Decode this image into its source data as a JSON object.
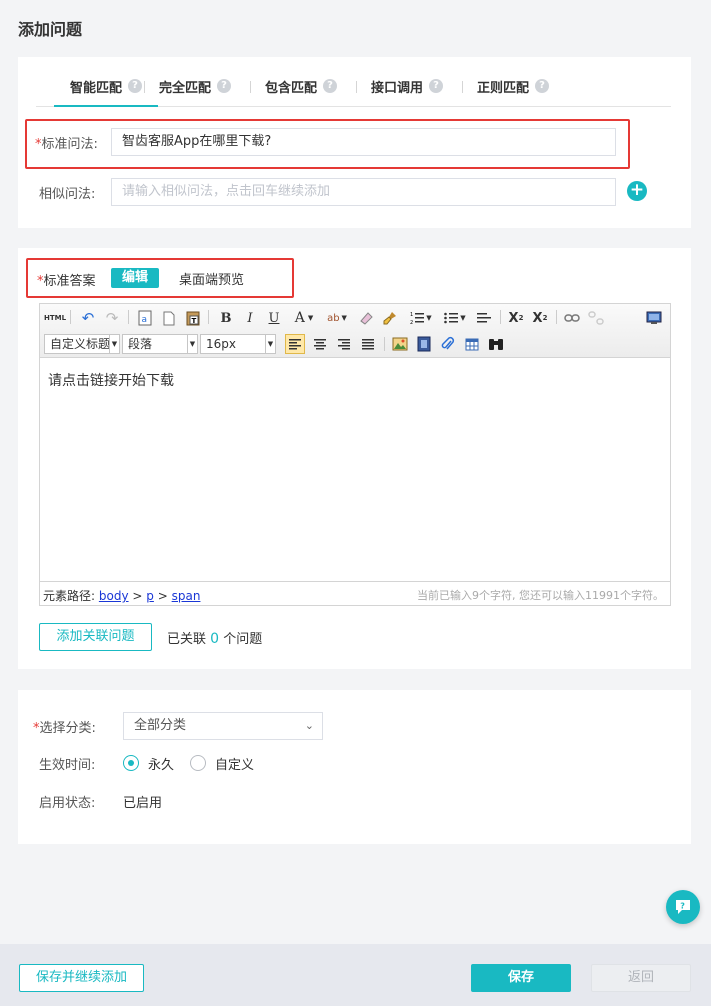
{
  "page": {
    "title": "添加问题"
  },
  "tabs": [
    {
      "label": "智能匹配",
      "active": true
    },
    {
      "label": "完全匹配"
    },
    {
      "label": "包含匹配"
    },
    {
      "label": "接口调用"
    },
    {
      "label": "正则匹配"
    }
  ],
  "icons": {
    "help": "question-mark-icon",
    "add": "plus-circle-icon",
    "chat": "chat-question-icon"
  },
  "question": {
    "required_mark": "*",
    "standard_label": "标准问法:",
    "standard_value": "智齿客服App在哪里下载?",
    "similar_label": "相似问法:",
    "similar_placeholder": "请输入相似问法，点击回车继续添加"
  },
  "answer": {
    "required_mark": "*",
    "label": "标准答案",
    "edit_label": "编辑",
    "preview_label": "桌面端预览",
    "toolbar": {
      "html": "HTML",
      "heading_select": "自定义标题",
      "paragraph_select": "段落",
      "font_size_select": "16px"
    },
    "content": "请点击链接开始下载",
    "status_path_label": "元素路径:",
    "status_path": [
      "body",
      "p",
      "span"
    ],
    "status_path_sep": ">",
    "char_count_text": "当前已输入9个字符, 您还可以输入11991个字符。",
    "add_related_label": "添加关联问题",
    "related_prefix": "已关联",
    "related_count": "0",
    "related_suffix": "个问题"
  },
  "settings": {
    "required_mark": "*",
    "category_label": "选择分类:",
    "category_value": "全部分类",
    "effective_label": "生效时间:",
    "effective_options": [
      {
        "label": "永久",
        "checked": true
      },
      {
        "label": "自定义",
        "checked": false
      }
    ],
    "status_label": "启用状态:",
    "status_value": "已启用"
  },
  "footer": {
    "save_continue_label": "保存并继续添加",
    "save_label": "保存",
    "back_label": "返回"
  },
  "colors": {
    "accent": "#19b9c2",
    "required": "#e53935",
    "link": "#1a37d6"
  }
}
